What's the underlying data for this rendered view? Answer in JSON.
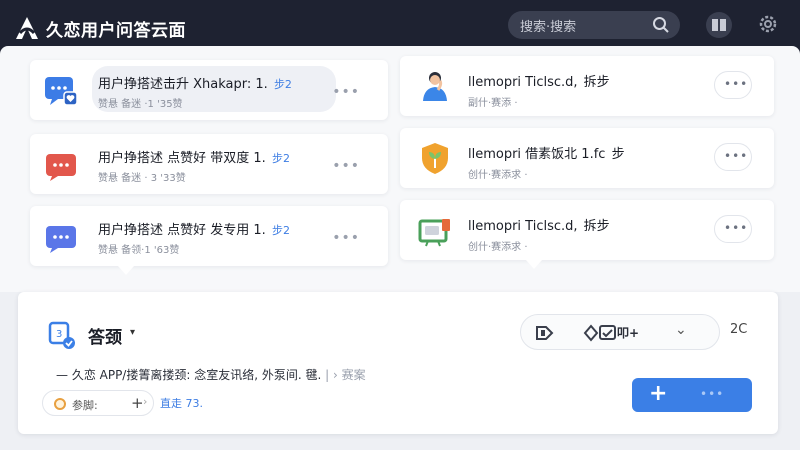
{
  "header": {
    "title": "久恋用户问答云面",
    "search_placeholder": "搜索·搜索"
  },
  "cards": [
    {
      "title": "用户挣搭述击升 Xhakapr: 1.",
      "tag": "步2",
      "subtitle": "赞悬 备迷 ·1 '35赞",
      "more": "•••",
      "icon": "chat-blue-icon"
    },
    {
      "title": "llemopri Ticlsc.d,",
      "tag": "拆步",
      "subtitle": "副什·赛添 ·",
      "more": "•••",
      "icon": "person-avatar-icon"
    },
    {
      "title": "用户挣搭述 点赞好 带双度 1.",
      "tag": "步2",
      "subtitle": "赞悬 备迷 · 3 '33赞",
      "more": "•••",
      "icon": "chat-red-icon"
    },
    {
      "title": "llemopri 借素饭北 1.fc",
      "tag": "步",
      "subtitle": "创什·赛添求 ·",
      "more": "•••",
      "icon": "shield-plant-icon"
    },
    {
      "title": "用户挣搭述 点赞好 发专用 1.",
      "tag": "步2",
      "subtitle": "赞悬 备领·1 '63赞",
      "more": "•••",
      "icon": "chat-purple-icon"
    },
    {
      "title": "llemopri Ticlsc.d,",
      "tag": "拆步",
      "subtitle": "创什·赛添求 ·",
      "more": "•••",
      "icon": "board-chat-icon"
    }
  ],
  "composer": {
    "title": "答颈",
    "caret": "▾",
    "toolbar_label": "叩+",
    "count": "2C",
    "description": "— 久恋 APP/搂箐离搂颈: 念室友讯络, 外泵间. 毽.",
    "description_tail": "| › 赛案",
    "chip_label": "参脚:",
    "chip_plus": "+",
    "link_text": "直走 73.",
    "send_plus": "+",
    "send_dots": "•••"
  },
  "colors": {
    "topbar": "#1e2231",
    "accent": "#3b7fe6",
    "card_bg": "#ffffff"
  }
}
